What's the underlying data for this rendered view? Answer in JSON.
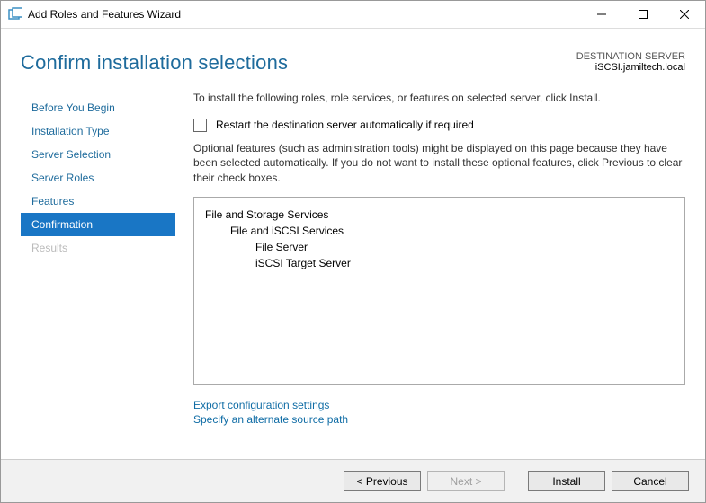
{
  "titlebar": {
    "title": "Add Roles and Features Wizard"
  },
  "header": {
    "page_title": "Confirm installation selections",
    "destination_label": "DESTINATION SERVER",
    "destination_value": "iSCSI.jamiltech.local"
  },
  "sidebar": {
    "items": [
      {
        "label": "Before You Begin",
        "state": "normal"
      },
      {
        "label": "Installation Type",
        "state": "normal"
      },
      {
        "label": "Server Selection",
        "state": "normal"
      },
      {
        "label": "Server Roles",
        "state": "normal"
      },
      {
        "label": "Features",
        "state": "normal"
      },
      {
        "label": "Confirmation",
        "state": "active"
      },
      {
        "label": "Results",
        "state": "disabled"
      }
    ]
  },
  "main": {
    "instruction": "To install the following roles, role services, or features on selected server, click Install.",
    "restart_checkbox_label": "Restart the destination server automatically if required",
    "optional_note": "Optional features (such as administration tools) might be displayed on this page because they have been selected automatically. If you do not want to install these optional features, click Previous to clear their check boxes.",
    "selections": [
      {
        "text": "File and Storage Services",
        "level": 0
      },
      {
        "text": "File and iSCSI Services",
        "level": 1
      },
      {
        "text": "File Server",
        "level": 2
      },
      {
        "text": "iSCSI Target Server",
        "level": 2
      }
    ],
    "link_export": "Export configuration settings",
    "link_altpath": "Specify an alternate source path"
  },
  "footer": {
    "previous": "< Previous",
    "next": "Next >",
    "install": "Install",
    "cancel": "Cancel"
  }
}
